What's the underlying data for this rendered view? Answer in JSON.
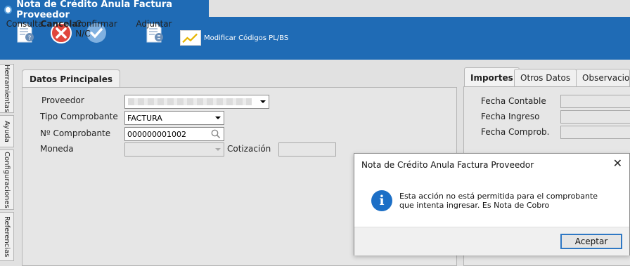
{
  "window": {
    "title": "Nota de Crédito Anula Factura Proveedor"
  },
  "toolbar": {
    "consulta": "Consulta",
    "cancelar": "Cancelar",
    "confirmar": "Confirmar N/C",
    "adjuntar": "Adjuntar",
    "modificar": "Modificar Códigos PL/BS"
  },
  "sidebar": {
    "items": [
      "Herramientas",
      "Ayuda",
      "Configuraciones",
      "Referencias"
    ]
  },
  "main": {
    "tab": "Datos Principales",
    "proveedor_label": "Proveedor",
    "tipo_label": "Tipo Comprobante",
    "tipo_value": "FACTURA",
    "numero_label": "Nº Comprobante",
    "numero_value": "000000001002",
    "moneda_label": "Moneda",
    "cotizacion_label": "Cotización"
  },
  "right": {
    "tabs": [
      "Importes",
      "Otros Datos",
      "Observaciones"
    ],
    "fecha_contable": "Fecha Contable",
    "fecha_ingreso": "Fecha Ingreso",
    "fecha_comprob": "Fecha Comprob."
  },
  "dialog": {
    "title": "Nota de Crédito Anula Factura Proveedor",
    "message": "Esta acción no está permitida para el comprobante que intenta ingresar. Es Nota de Cobro",
    "ok": "Aceptar",
    "icon": "info-icon"
  },
  "colors": {
    "toolbar": "#1f6bb5",
    "dialog_button_border": "#2f78c4"
  }
}
